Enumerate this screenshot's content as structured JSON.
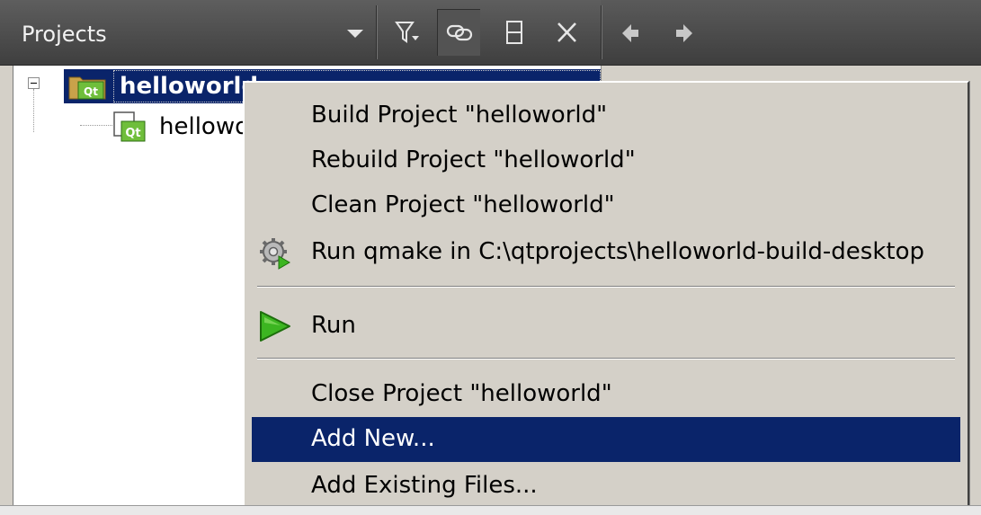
{
  "toolbar": {
    "title": "Projects",
    "icons": [
      "chevron-down-icon",
      "filter-icon",
      "link-icon",
      "split-icon",
      "close-icon",
      "arrow-left-icon",
      "arrow-right-icon"
    ]
  },
  "tree": {
    "root": {
      "label": "helloworld",
      "icon": "qt-folder-icon"
    },
    "child": {
      "label": "hellowo",
      "icon": "qt-project-file-icon"
    }
  },
  "context_menu": {
    "items": [
      {
        "label": "Build Project \"helloworld\""
      },
      {
        "label": "Rebuild Project \"helloworld\""
      },
      {
        "label": "Clean Project \"helloworld\""
      },
      {
        "label": "Run qmake in C:\\qtprojects\\helloworld-build-desktop",
        "icon": "gear-run-icon"
      },
      {
        "label": "Run",
        "icon": "play-icon"
      },
      {
        "label": "Close Project \"helloworld\""
      },
      {
        "label": "Add New...",
        "highlighted": true
      },
      {
        "label": "Add Existing Files..."
      }
    ]
  },
  "colors": {
    "toolbar_bg": "#4a4a4a",
    "selection": "#0a246a",
    "menu_bg": "#d4d0c8",
    "run_green": "#3cb521"
  }
}
